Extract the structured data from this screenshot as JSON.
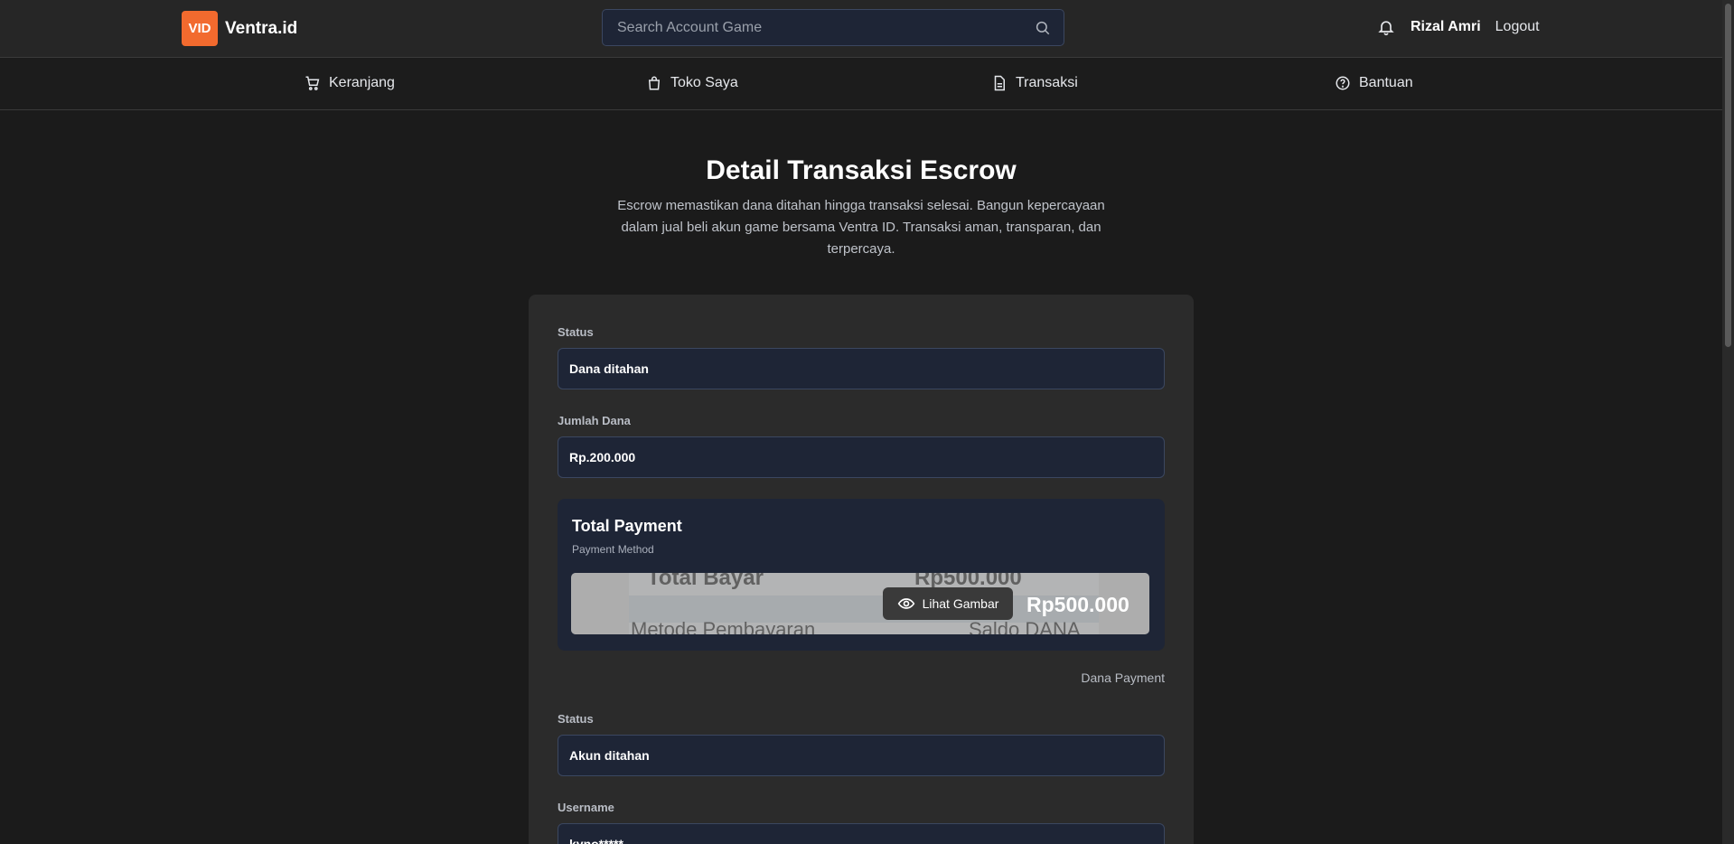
{
  "header": {
    "logo_badge": "VID",
    "logo_text": "Ventra.id",
    "search_placeholder": "Search Account Game",
    "user_name": "Rizal Amri",
    "logout_label": "Logout"
  },
  "nav": {
    "items": [
      {
        "label": "Keranjang",
        "icon": "cart-icon"
      },
      {
        "label": "Toko Saya",
        "icon": "bag-icon"
      },
      {
        "label": "Transaksi",
        "icon": "document-icon"
      },
      {
        "label": "Bantuan",
        "icon": "help-icon"
      }
    ]
  },
  "main": {
    "title": "Detail Transaksi Escrow",
    "subtitle": "Escrow memastikan dana ditahan hingga transaksi selesai. Bangun kepercayaan dalam jual beli akun game bersama Ventra ID. Transaksi aman, transparan, dan terpercaya.",
    "fields": [
      {
        "label": "Status",
        "value": "Dana ditahan"
      },
      {
        "label": "Jumlah Dana",
        "value": "Rp.200.000"
      }
    ],
    "payment": {
      "title": "Total Payment",
      "method_label": "Payment Method",
      "image_texts": [
        "Total Bayar",
        "Rp500.000",
        "Metode Pembayaran",
        "Saldo DANA"
      ],
      "view_button": "Lihat Gambar",
      "amount": "Rp500.000",
      "provider": "Dana Payment"
    },
    "account_fields": [
      {
        "label": "Status",
        "value": "Akun ditahan"
      },
      {
        "label": "Username",
        "value": "kyno*****"
      }
    ]
  },
  "colors": {
    "accent": "#f26a2e",
    "background": "#1b1b1b",
    "card": "#2b2b2b",
    "field": "#1e2536"
  }
}
